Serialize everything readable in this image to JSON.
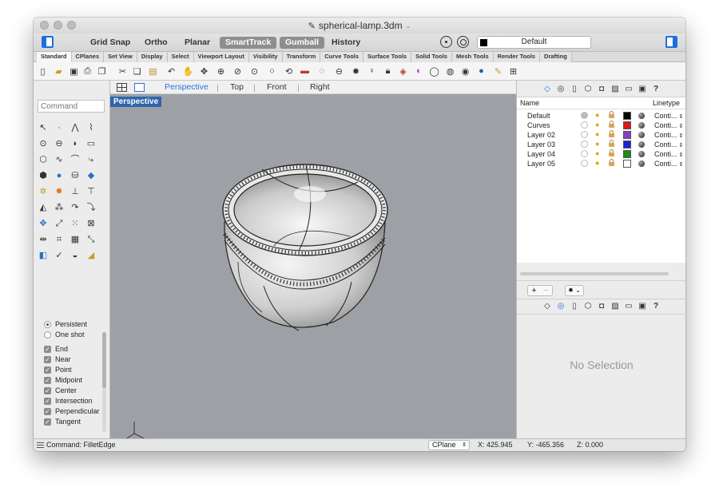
{
  "window": {
    "title": "spherical-lamp.3dm"
  },
  "modebar": {
    "modes": [
      {
        "label": "Grid Snap",
        "active": false
      },
      {
        "label": "Ortho",
        "active": false
      },
      {
        "label": "Planar",
        "active": false
      },
      {
        "label": "SmartTrack",
        "active": true
      },
      {
        "label": "Gumball",
        "active": true
      },
      {
        "label": "History",
        "active": false
      }
    ],
    "layer_select": "Default"
  },
  "tabs": [
    "Standard",
    "CPlanes",
    "Set View",
    "Display",
    "Select",
    "Viewport Layout",
    "Visibility",
    "Transform",
    "Curve Tools",
    "Surface Tools",
    "Solid Tools",
    "Mesh Tools",
    "Render Tools",
    "Drafting"
  ],
  "active_tab": "Standard",
  "viewport_tabs": [
    "Perspective",
    "Top",
    "Front",
    "Right"
  ],
  "active_viewport": "Perspective",
  "viewport_label": "Perspective",
  "command": {
    "placeholder": "Command"
  },
  "osnap": {
    "modes": [
      {
        "label": "Persistent",
        "selected": true
      },
      {
        "label": "One shot",
        "selected": false
      }
    ],
    "snaps": [
      {
        "label": "End",
        "checked": true
      },
      {
        "label": "Near",
        "checked": true
      },
      {
        "label": "Point",
        "checked": true
      },
      {
        "label": "Midpoint",
        "checked": true
      },
      {
        "label": "Center",
        "checked": true
      },
      {
        "label": "Intersection",
        "checked": true
      },
      {
        "label": "Perpendicular",
        "checked": true
      },
      {
        "label": "Tangent",
        "checked": true
      }
    ]
  },
  "layers": {
    "headers": {
      "name": "Name",
      "linetype": "Linetype"
    },
    "rows": [
      {
        "name": "Default",
        "current": true,
        "color": "#000000",
        "linetype": "Conti..."
      },
      {
        "name": "Curves",
        "current": false,
        "color": "#e0141b",
        "linetype": "Conti..."
      },
      {
        "name": "Layer 02",
        "current": false,
        "color": "#8a3fcc",
        "linetype": "Conti..."
      },
      {
        "name": "Layer 03",
        "current": false,
        "color": "#1a22d6",
        "linetype": "Conti..."
      },
      {
        "name": "Layer 04",
        "current": false,
        "color": "#1d8a1d",
        "linetype": "Conti..."
      },
      {
        "name": "Layer 05",
        "current": false,
        "color": "#ffffff",
        "linetype": "Conti..."
      }
    ]
  },
  "properties": {
    "empty_text": "No Selection"
  },
  "status": {
    "command": "Command: FilletEdge",
    "cplane": "CPlane",
    "x": "X: 425.945",
    "y": "Y: -465.356",
    "z": "Z: 0.000"
  },
  "icons": {
    "toolbar": [
      "new-file-icon",
      "open-icon",
      "save-icon",
      "print-icon",
      "import-icon",
      "cut-icon",
      "copy-icon",
      "paste-icon",
      "undo-icon",
      "pan-icon",
      "rotate-view-icon",
      "zoom-window-icon",
      "zoom-extents-icon",
      "zoom-selected-icon",
      "zoom-icon",
      "redraw-icon",
      "car-icon",
      "render-icon",
      "snap-icon",
      "gear-icon",
      "light-icon",
      "lock-icon",
      "layer-icon",
      "color-icon",
      "sphere-icon",
      "globe-icon",
      "shade-icon",
      "material-icon",
      "pencil-icon",
      "grid-icon"
    ]
  }
}
